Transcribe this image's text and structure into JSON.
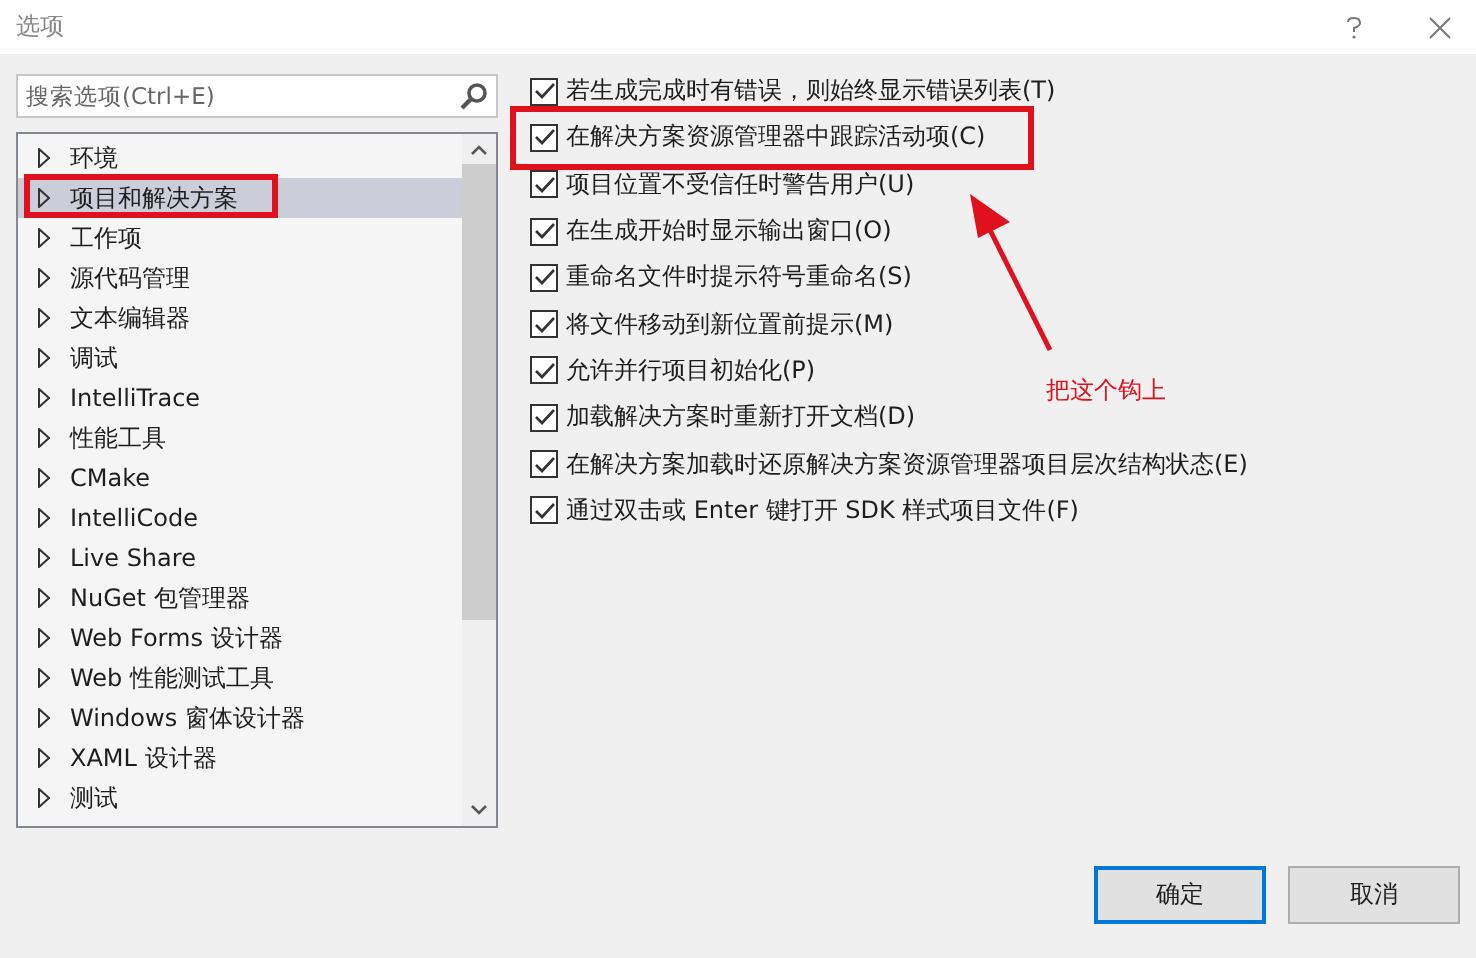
{
  "window": {
    "title": "选项"
  },
  "search": {
    "placeholder": "搜索选项(Ctrl+E)"
  },
  "tree": [
    {
      "label": "环境",
      "selected": false,
      "highlighted": false
    },
    {
      "label": "项目和解决方案",
      "selected": true,
      "highlighted": true
    },
    {
      "label": "工作项",
      "selected": false,
      "highlighted": false
    },
    {
      "label": "源代码管理",
      "selected": false,
      "highlighted": false
    },
    {
      "label": "文本编辑器",
      "selected": false,
      "highlighted": false
    },
    {
      "label": "调试",
      "selected": false,
      "highlighted": false
    },
    {
      "label": "IntelliTrace",
      "selected": false,
      "highlighted": false
    },
    {
      "label": "性能工具",
      "selected": false,
      "highlighted": false
    },
    {
      "label": "CMake",
      "selected": false,
      "highlighted": false
    },
    {
      "label": "IntelliCode",
      "selected": false,
      "highlighted": false
    },
    {
      "label": "Live Share",
      "selected": false,
      "highlighted": false
    },
    {
      "label": "NuGet 包管理器",
      "selected": false,
      "highlighted": false
    },
    {
      "label": "Web Forms 设计器",
      "selected": false,
      "highlighted": false
    },
    {
      "label": "Web 性能测试工具",
      "selected": false,
      "highlighted": false
    },
    {
      "label": "Windows 窗体设计器",
      "selected": false,
      "highlighted": false
    },
    {
      "label": "XAML 设计器",
      "selected": false,
      "highlighted": false
    },
    {
      "label": "测试",
      "selected": false,
      "highlighted": false
    }
  ],
  "options": [
    {
      "label": "若生成完成时有错误，则始终显示错误列表(T)",
      "checked": true,
      "highlighted": false
    },
    {
      "label": "在解决方案资源管理器中跟踪活动项(C)",
      "checked": true,
      "highlighted": true
    },
    {
      "label": "项目位置不受信任时警告用户(U)",
      "checked": true,
      "highlighted": false
    },
    {
      "label": "在生成开始时显示输出窗口(O)",
      "checked": true,
      "highlighted": false
    },
    {
      "label": "重命名文件时提示符号重命名(S)",
      "checked": true,
      "highlighted": false
    },
    {
      "label": "将文件移动到新位置前提示(M)",
      "checked": true,
      "highlighted": false
    },
    {
      "label": "允许并行项目初始化(P)",
      "checked": true,
      "highlighted": false
    },
    {
      "label": "加载解决方案时重新打开文档(D)",
      "checked": true,
      "highlighted": false
    },
    {
      "label": "在解决方案加载时还原解决方案资源管理器项目层次结构状态(E)",
      "checked": true,
      "highlighted": false
    },
    {
      "label": "通过双击或 Enter 键打开 SDK 样式项目文件(F)",
      "checked": true,
      "highlighted": false
    }
  ],
  "annotation": {
    "note": "把这个钩上"
  },
  "buttons": [
    {
      "label": "确定",
      "default": true
    },
    {
      "label": "取消",
      "default": false
    }
  ]
}
